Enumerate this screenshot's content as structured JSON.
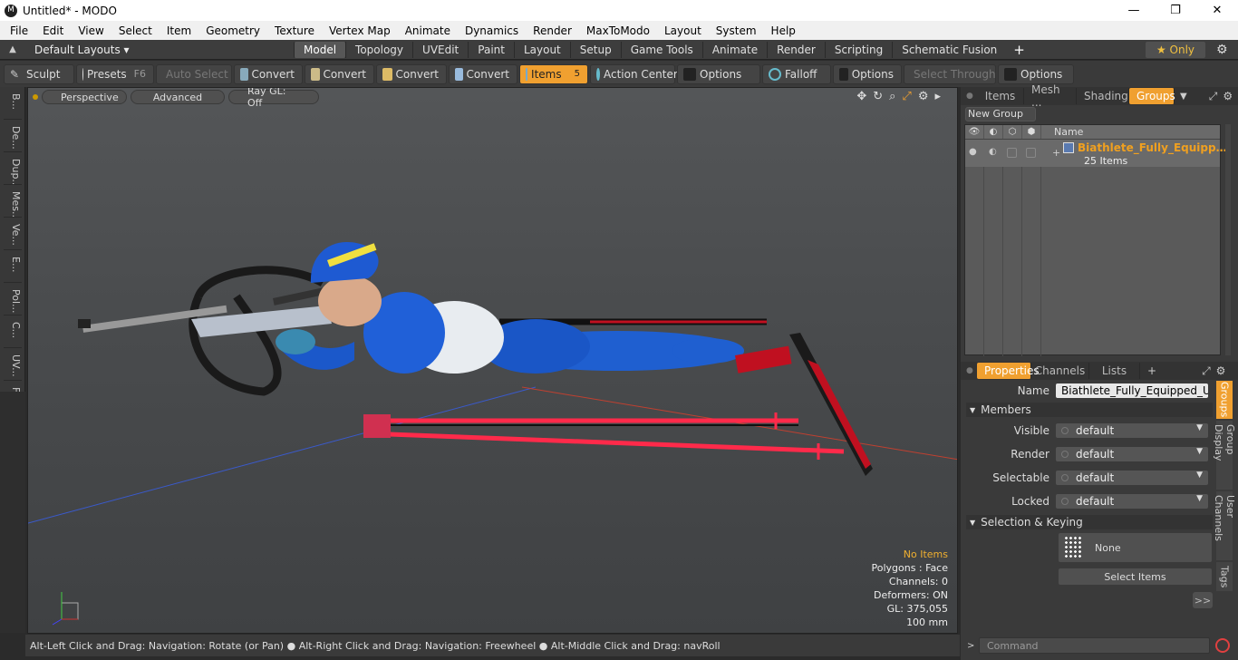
{
  "window": {
    "title": "Untitled* - MODO",
    "logo": "M",
    "buttons": [
      "—",
      "❐",
      "✕"
    ]
  },
  "menu": [
    "File",
    "Edit",
    "View",
    "Select",
    "Item",
    "Geometry",
    "Texture",
    "Vertex Map",
    "Animate",
    "Dynamics",
    "Render",
    "MaxToModo",
    "Layout",
    "System",
    "Help"
  ],
  "layoutbar": {
    "preset": "Default Layouts ▾",
    "tabs": [
      "Model",
      "Topology",
      "UVEdit",
      "Paint",
      "Layout",
      "Setup",
      "Game Tools",
      "Animate",
      "Render",
      "Scripting",
      "Schematic Fusion"
    ],
    "active": "Model",
    "add": "+",
    "only": "★  Only"
  },
  "toolbar": {
    "sculpt": "Sculpt",
    "presets": "Presets",
    "presets_key": "F6",
    "auto_select": "Auto Select",
    "convert1": "Convert",
    "convert2": "Convert",
    "convert3": "Convert",
    "convert4": "Convert",
    "items": "Items",
    "items_key": "5",
    "action_center": "Action Center",
    "options1": "Options",
    "falloff": "Falloff",
    "options2": "Options",
    "select_through": "Select Through",
    "options3": "Options"
  },
  "lefttabs": [
    "B...",
    "De...",
    "Dup...",
    "Mes...",
    "Ve...",
    "E...",
    "Pol...",
    "C...",
    "UV...",
    "F..."
  ],
  "viewport": {
    "view": "Perspective",
    "mode": "Advanced",
    "raygl": "Ray GL: Off",
    "info": {
      "items": "No Items",
      "polygons": "Polygons : Face",
      "channels": "Channels: 0",
      "deformers": "Deformers: ON",
      "gl": "GL: 375,055",
      "scale": "100 mm"
    }
  },
  "statusbar": "Alt-Left Click and Drag: Navigation: Rotate (or Pan) ● Alt-Right Click and Drag: Navigation: Freewheel ● Alt-Middle Click and Drag: navRoll",
  "groups": {
    "tabs": [
      "Items",
      "Mesh ...",
      "Shading",
      "Groups"
    ],
    "active": "Groups",
    "new_group": "New Group",
    "col_name": "Name",
    "group_name": "Biathlete_Fully_Equipped_USA_T",
    "group_count": "25 Items"
  },
  "properties": {
    "tabs": [
      "Properties",
      "Channels",
      "Lists"
    ],
    "add": "+",
    "name_label": "Name",
    "name_value": "Biathlete_Fully_Equipped_USA_T",
    "members": "Members",
    "visible_label": "Visible",
    "visible": "default",
    "render_label": "Render",
    "render": "default",
    "selectable_label": "Selectable",
    "selectable": "default",
    "locked_label": "Locked",
    "locked": "default",
    "sel_keying": "Selection & Keying",
    "none": "None",
    "select_items": "Select Items",
    "more": ">>"
  },
  "vtabs": [
    "Groups",
    "Group Display",
    "User Channels",
    "Tags"
  ],
  "command": {
    "placeholder": "Command"
  }
}
